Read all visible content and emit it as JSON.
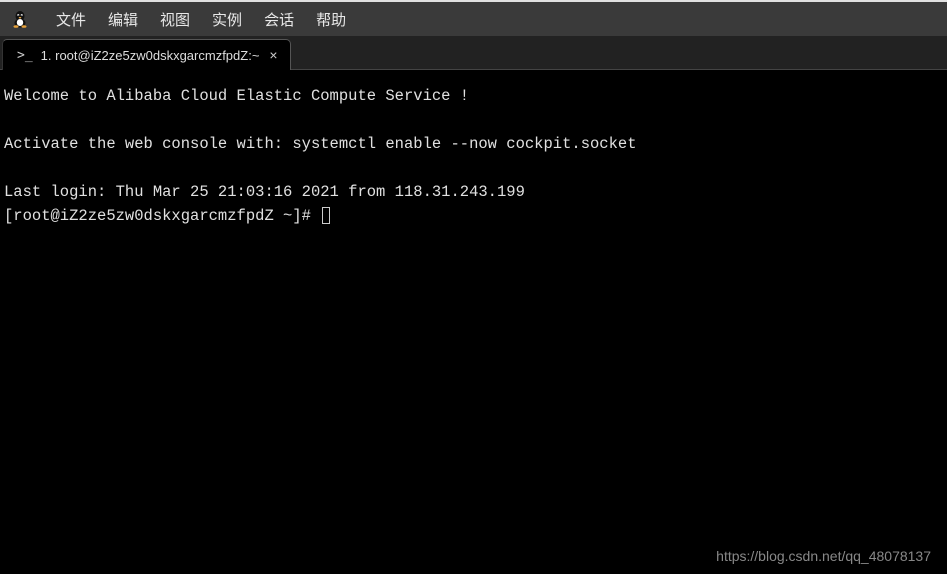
{
  "menubar": {
    "items": [
      "文件",
      "编辑",
      "视图",
      "实例",
      "会话",
      "帮助"
    ]
  },
  "tab": {
    "prefix": ">_",
    "title": "1. root@iZ2ze5zw0dskxgarcmzfpdZ:~",
    "close": "×"
  },
  "terminal": {
    "line1": "Welcome to Alibaba Cloud Elastic Compute Service !",
    "line2": "",
    "line3": "Activate the web console with: systemctl enable --now cockpit.socket",
    "line4": "",
    "line5": "Last login: Thu Mar 25 21:03:16 2021 from 118.31.243.199",
    "prompt": "[root@iZ2ze5zw0dskxgarcmzfpdZ ~]# "
  },
  "watermark": "https://blog.csdn.net/qq_48078137"
}
